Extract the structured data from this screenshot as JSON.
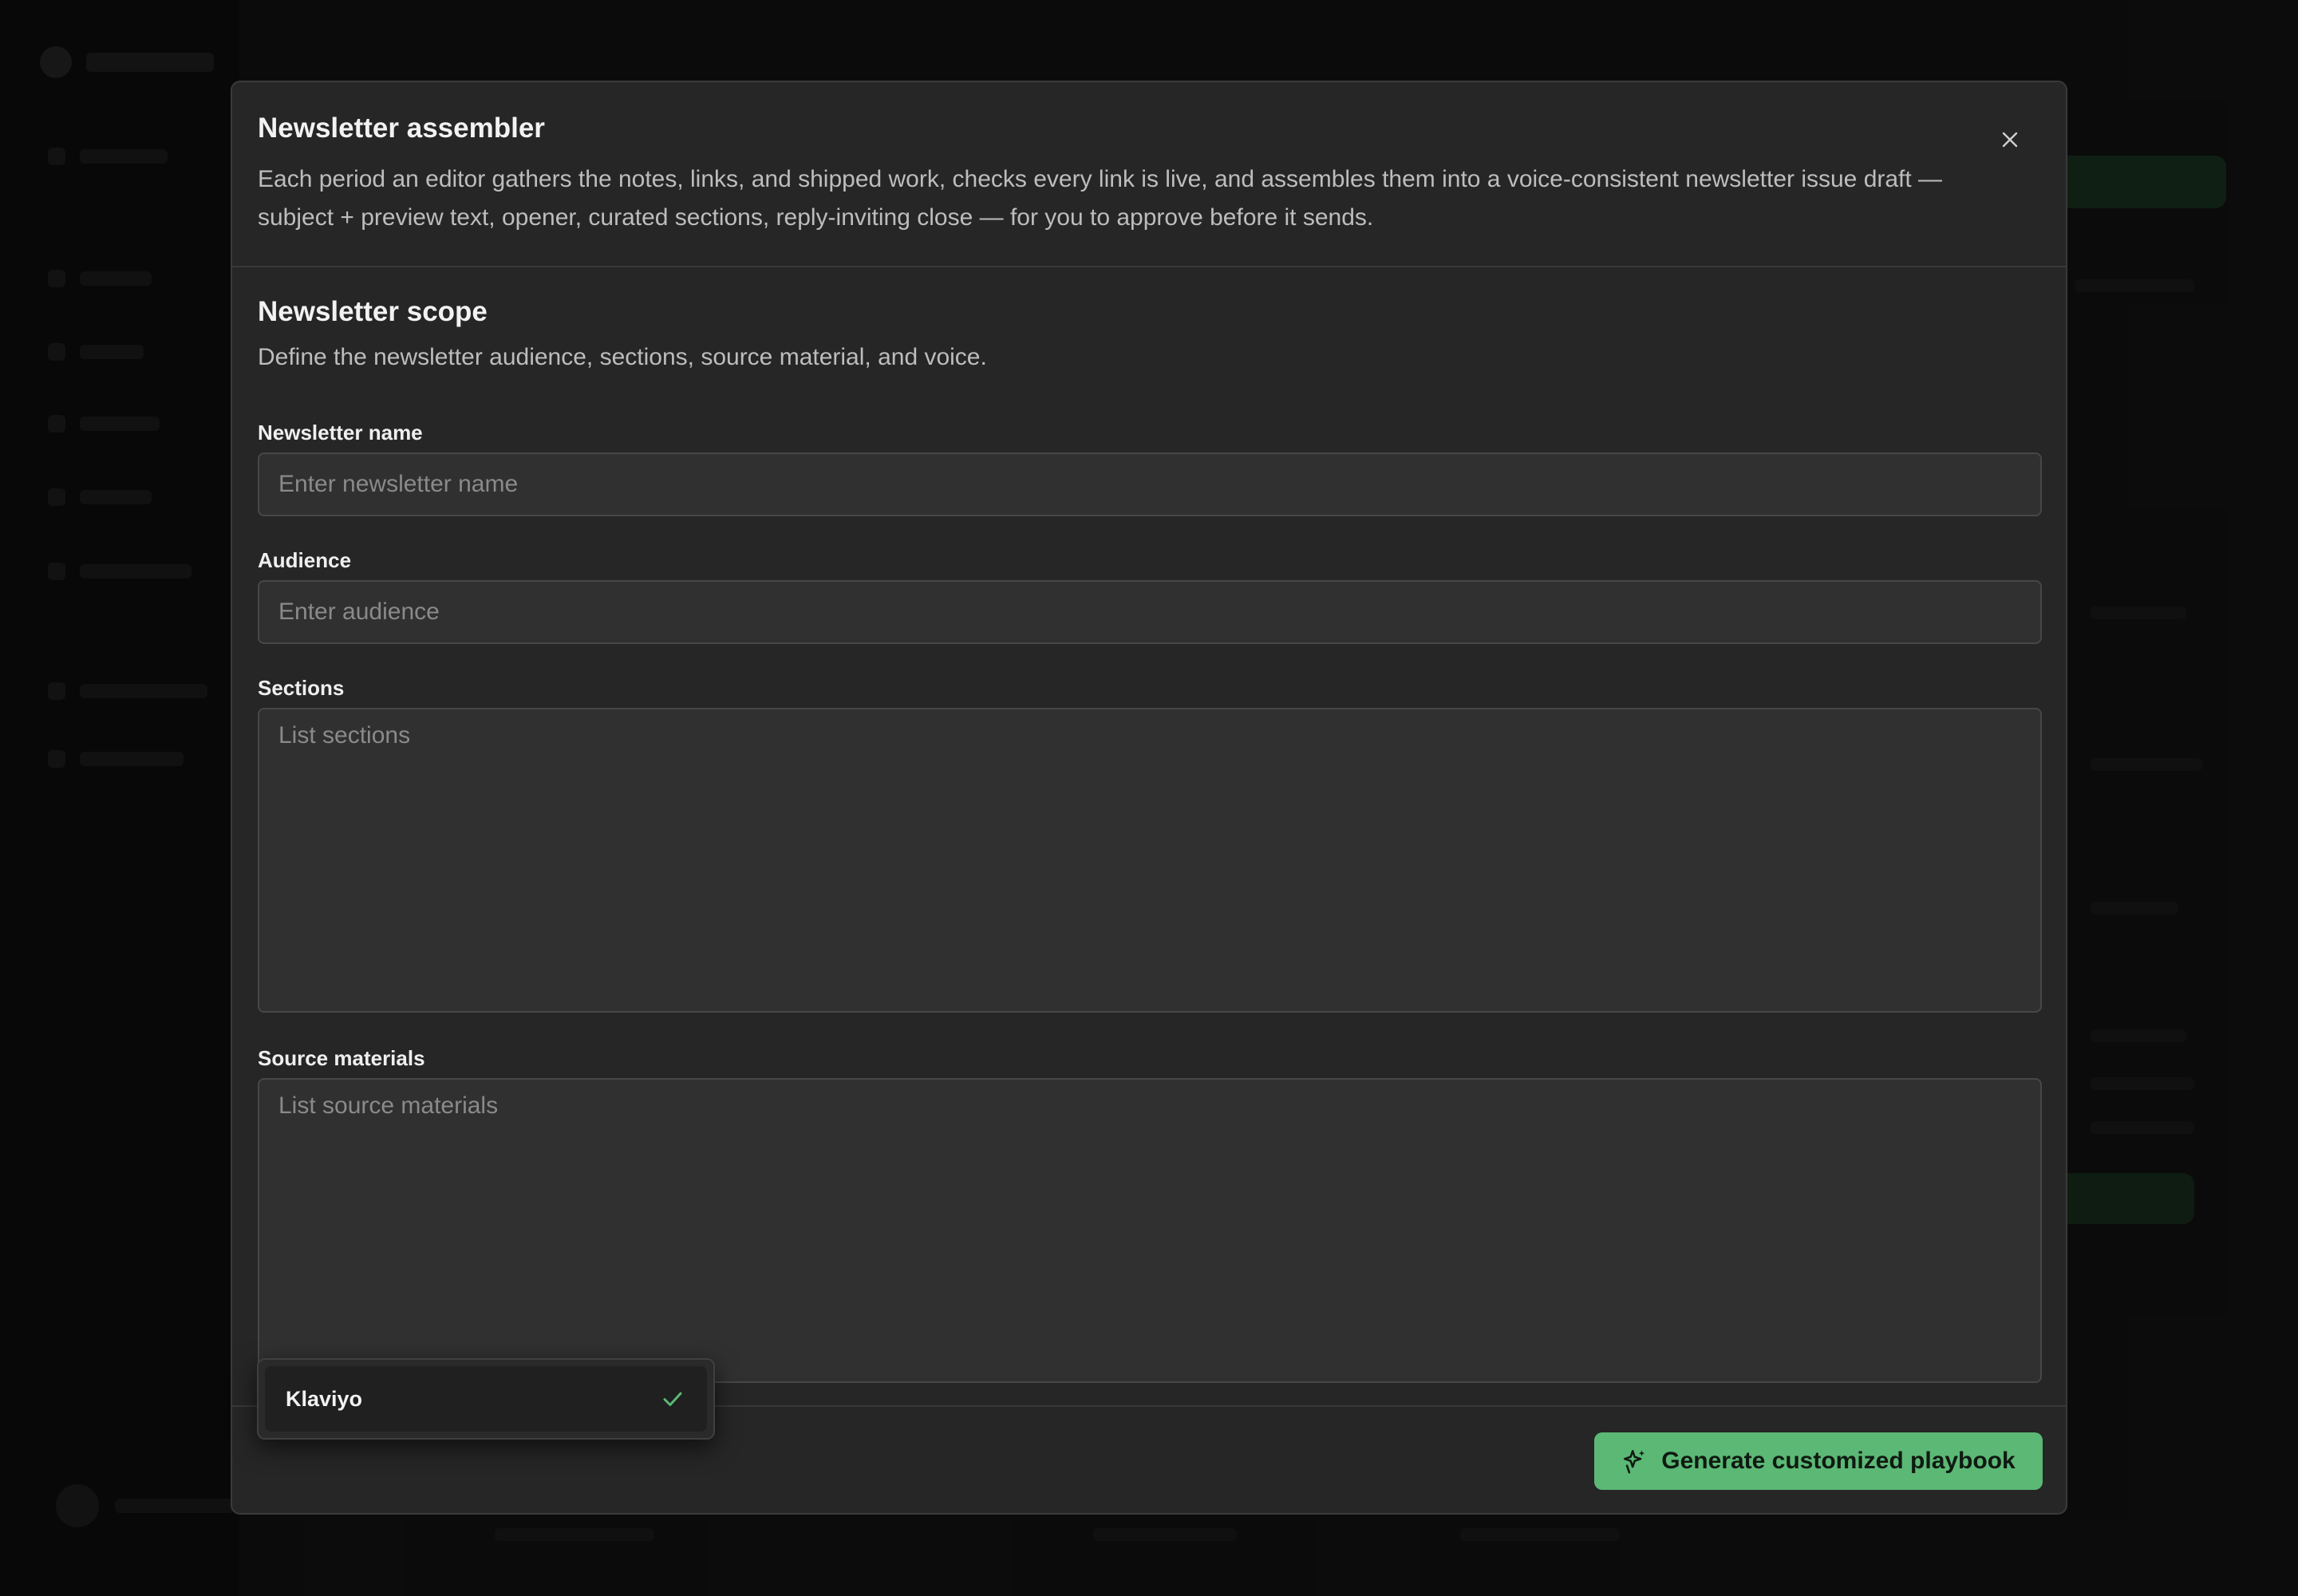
{
  "modal": {
    "title": "Newsletter assembler",
    "description": "Each period an editor gathers the notes, links, and shipped work, checks every link is live, and assembles them into a voice-consistent newsletter issue draft — subject + preview text, opener, curated sections, reply-inviting close — for you to approve before it sends.",
    "close_icon": "close-icon"
  },
  "section": {
    "title": "Newsletter scope",
    "description": "Define the newsletter audience, sections, source material, and voice."
  },
  "fields": {
    "newsletter_name": {
      "label": "Newsletter name",
      "value": "",
      "placeholder": "Enter newsletter name"
    },
    "audience": {
      "label": "Audience",
      "value": "",
      "placeholder": "Enter audience"
    },
    "sections": {
      "label": "Sections",
      "value": "",
      "placeholder": "List sections"
    },
    "source_materials": {
      "label": "Source materials",
      "value": "",
      "placeholder": "List source materials"
    }
  },
  "dropdown": {
    "selected_option": "Klaviyo",
    "selected_icon": "check-icon"
  },
  "footer": {
    "generate_label": "Generate customized playbook",
    "generate_icon": "sparkles-icon"
  },
  "colors": {
    "accent": "#5cb875",
    "modal_background": "#262626",
    "input_background": "#303030"
  }
}
